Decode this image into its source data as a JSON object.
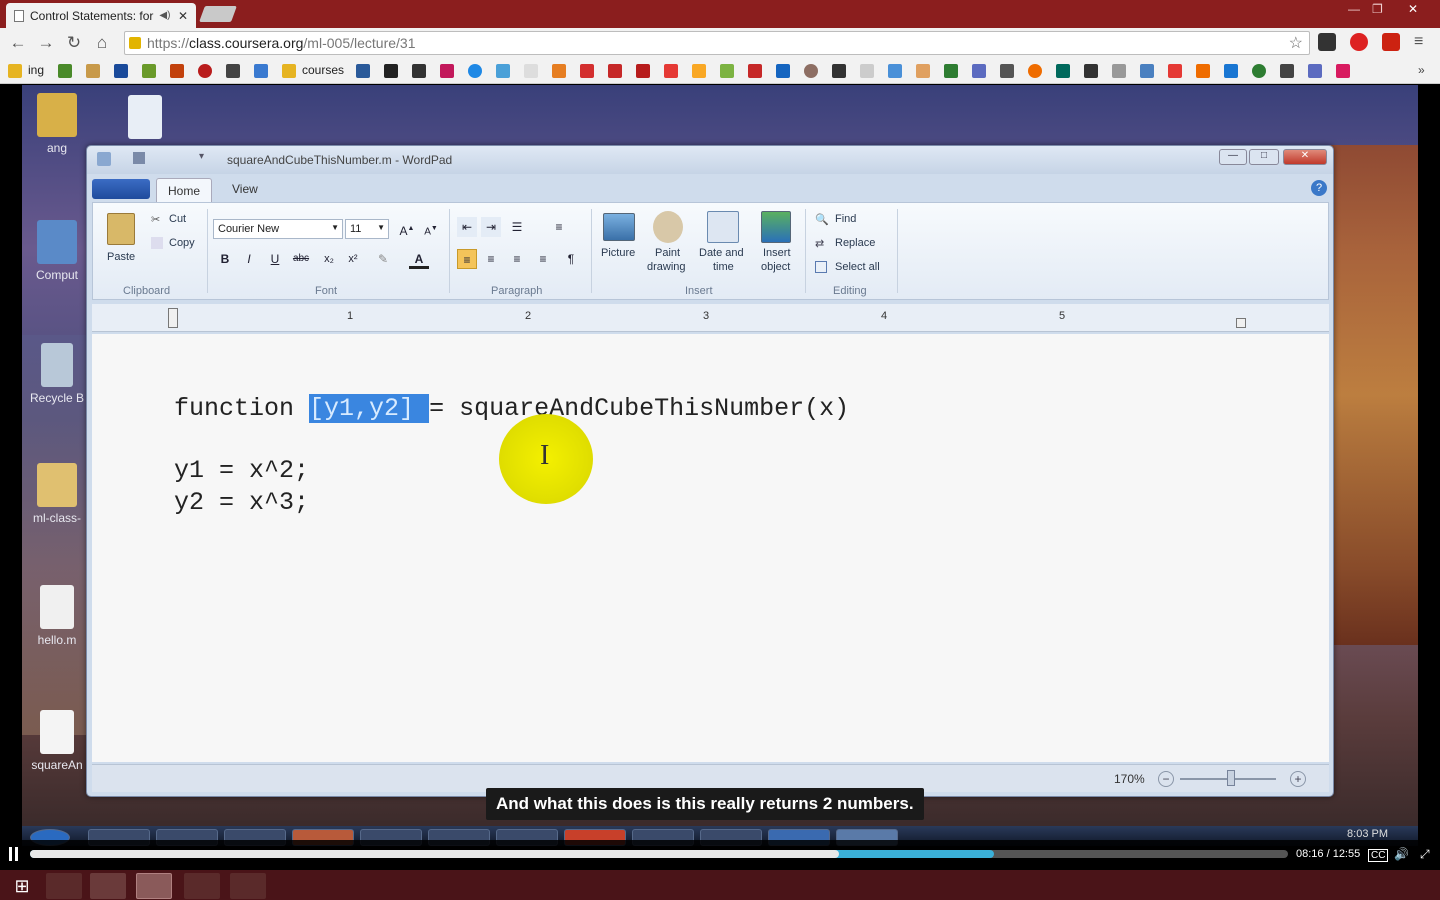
{
  "browser": {
    "tab_title": "Control Statements: for",
    "url_scheme": "https://",
    "url_host": "class.coursera.org",
    "url_path": "/ml-005/lecture/31",
    "bookmarks": [
      "ing",
      "courses"
    ]
  },
  "desktop": {
    "icons": [
      "ang",
      "Comput",
      "Recycle B",
      "ml-class-",
      "hello.m",
      "squareAn"
    ]
  },
  "wordpad": {
    "title": "squareAndCubeThisNumber.m - WordPad",
    "tabs": [
      "Home",
      "View"
    ],
    "clipboard": {
      "paste": "Paste",
      "cut": "Cut",
      "copy": "Copy",
      "label": "Clipboard"
    },
    "font": {
      "family": "Courier New",
      "size": "11",
      "label": "Font"
    },
    "paragraph_label": "Paragraph",
    "insert": {
      "picture": "Picture",
      "paint1": "Paint",
      "paint2": "drawing",
      "date1": "Date and",
      "date2": "time",
      "obj1": "Insert",
      "obj2": "object",
      "label": "Insert"
    },
    "editing": {
      "find": "Find",
      "replace": "Replace",
      "select_all": "Select all",
      "label": "Editing"
    },
    "ruler": [
      "1",
      "2",
      "3",
      "4",
      "5"
    ],
    "code": {
      "line1_pre": "function ",
      "line1_sel": "[y1,y2] ",
      "line1_post": "= squareAndCubeThisNumber(x)",
      "line2": "y1 = x^2;",
      "line3": "y2 = x^3;"
    },
    "zoom": "170%"
  },
  "video": {
    "caption": "And what this does is this really returns 2 numbers.",
    "time": "08:16 / 12:55",
    "played_fraction": 0.643,
    "buffered_fraction": 0.766,
    "recorded_clock": "8:03 PM"
  },
  "colors": {
    "chrome": "#8b1e1e",
    "selection": "#3a86e0",
    "cursor_highlight": "#f4f000",
    "progress": "#3bb0d8"
  }
}
